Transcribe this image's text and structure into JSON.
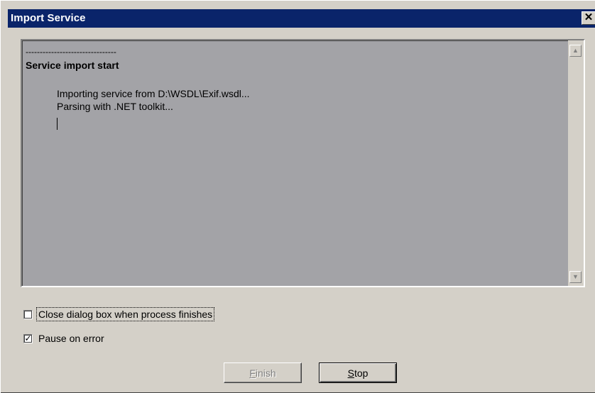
{
  "window": {
    "title": "Import Service",
    "close_glyph": "✕"
  },
  "log": {
    "divider": "--------------------------------",
    "heading": "Service import start",
    "lines": [
      "Importing service from D:\\WSDL\\Exif.wsdl...",
      "Parsing with .NET toolkit..."
    ]
  },
  "scrollbar": {
    "up_icon": "scroll-up-arrow-icon",
    "down_icon": "scroll-down-arrow-icon"
  },
  "options": {
    "close_dialog": {
      "label": "Close dialog box when process finishes",
      "checked": false
    },
    "pause_on_error": {
      "label": "Pause on error",
      "checked": true
    }
  },
  "buttons": {
    "finish": {
      "mnemonic": "F",
      "rest": "inish",
      "enabled": false
    },
    "stop": {
      "mnemonic": "S",
      "rest": "top",
      "enabled": true
    }
  },
  "colors": {
    "titlebar": "#0a246a",
    "dialog_bg": "#d4d0c8",
    "log_bg": "#a3a3a7"
  }
}
